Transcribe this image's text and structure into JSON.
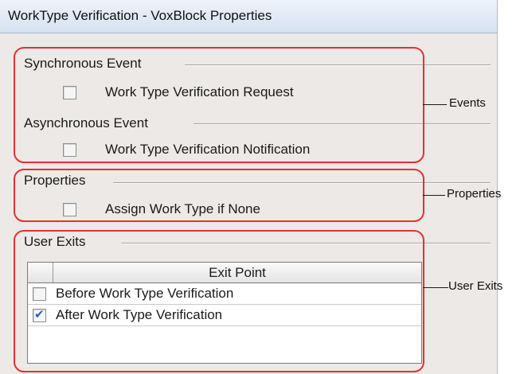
{
  "window": {
    "title": "WorkType Verification - VoxBlock Properties"
  },
  "events": {
    "sync_title": "Synchronous Event",
    "sync_item": "Work Type Verification Request",
    "async_title": "Asynchronous Event",
    "async_item": "Work Type Verification Notification"
  },
  "properties": {
    "title": "Properties",
    "item": "Assign Work Type if None"
  },
  "user_exits": {
    "title": "User Exits",
    "column": "Exit Point",
    "rows": [
      {
        "label": "Before Work Type Verification",
        "checked": false
      },
      {
        "label": "After Work Type Verification",
        "checked": true
      }
    ]
  },
  "callouts": {
    "events": "Events",
    "properties": "Properties",
    "user_exits": "User Exits"
  },
  "colors": {
    "callout": "#e8302f",
    "check": "#2a5fb3"
  }
}
